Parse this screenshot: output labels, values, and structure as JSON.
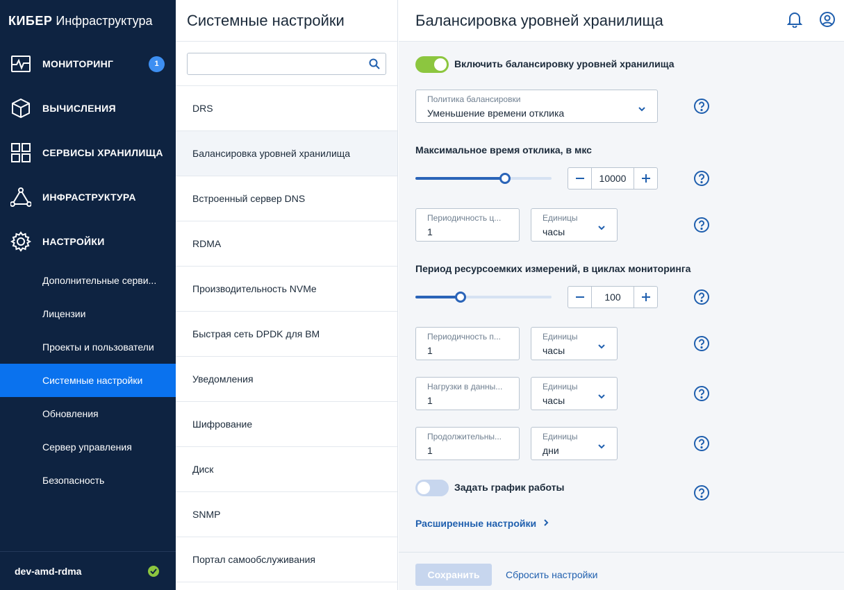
{
  "sidebar": {
    "logo_bold": "КИБЕР",
    "logo_rest": "Инфраструктура",
    "nav": [
      {
        "label": "МОНИТОРИНГ",
        "icon": "monitoring-icon",
        "badge": "1"
      },
      {
        "label": "ВЫЧИСЛЕНИЯ",
        "icon": "cube-icon"
      },
      {
        "label": "СЕРВИСЫ ХРАНИЛИЩА",
        "icon": "grid-icon"
      },
      {
        "label": "ИНФРАСТРУКТУРА",
        "icon": "network-icon"
      },
      {
        "label": "НАСТРОЙКИ",
        "icon": "gear-icon"
      }
    ],
    "subitems": [
      "Дополнительные серви...",
      "Лицензии",
      "Проекты и пользователи",
      "Системные настройки",
      "Обновления",
      "Сервер управления",
      "Безопасность"
    ],
    "active_subitem": "Системные настройки",
    "footer_host": "dev-amd-rdma",
    "footer_status_color": "#8cc63f"
  },
  "middle": {
    "title": "Системные настройки",
    "search_placeholder": "",
    "items": [
      "DRS",
      "Балансировка уровней хранилища",
      "Встроенный сервер DNS",
      "RDMA",
      "Производительность NVMe",
      "Быстрая сеть DPDK для ВМ",
      "Уведомления",
      "Шифрование",
      "Диск",
      "SNMP",
      "Портал самообслуживания"
    ],
    "active_item": "Балансировка уровней хранилища"
  },
  "right": {
    "title": "Балансировка уровней хранилища",
    "enable_toggle": {
      "label": "Включить балансировку уровней хранилища",
      "on": true
    },
    "policy": {
      "label": "Политика балансировки",
      "value": "Уменьшение времени отклика"
    },
    "max_response": {
      "title": "Максимальное время отклика, в мкс",
      "slider_fraction": 0.66,
      "value": "10000"
    },
    "periodicity1": {
      "label": "Периодичность ц...",
      "value": "1",
      "unit_label": "Единицы",
      "unit_value": "часы"
    },
    "resource_period": {
      "title": "Период ресурсоемких измерений, в циклах мониторинга",
      "slider_fraction": 0.33,
      "value": "100"
    },
    "periodicity2": {
      "label": "Периодичность п...",
      "value": "1",
      "unit_label": "Единицы",
      "unit_value": "часы"
    },
    "load": {
      "label": "Нагрузки в данны...",
      "value": "1",
      "unit_label": "Единицы",
      "unit_value": "часы"
    },
    "duration": {
      "label": "Продолжительны...",
      "value": "1",
      "unit_label": "Единицы",
      "unit_value": "дни"
    },
    "schedule_toggle": {
      "label": "Задать график работы",
      "on": false
    },
    "advanced_link": "Расширенные настройки",
    "save_button": "Сохранить",
    "reset_button": "Сбросить настройки"
  },
  "colors": {
    "sidebar_bg": "#0e2341",
    "active_blue": "#0a72ee",
    "toggle_on": "#8cc63f",
    "link_blue": "#1f5fae"
  }
}
